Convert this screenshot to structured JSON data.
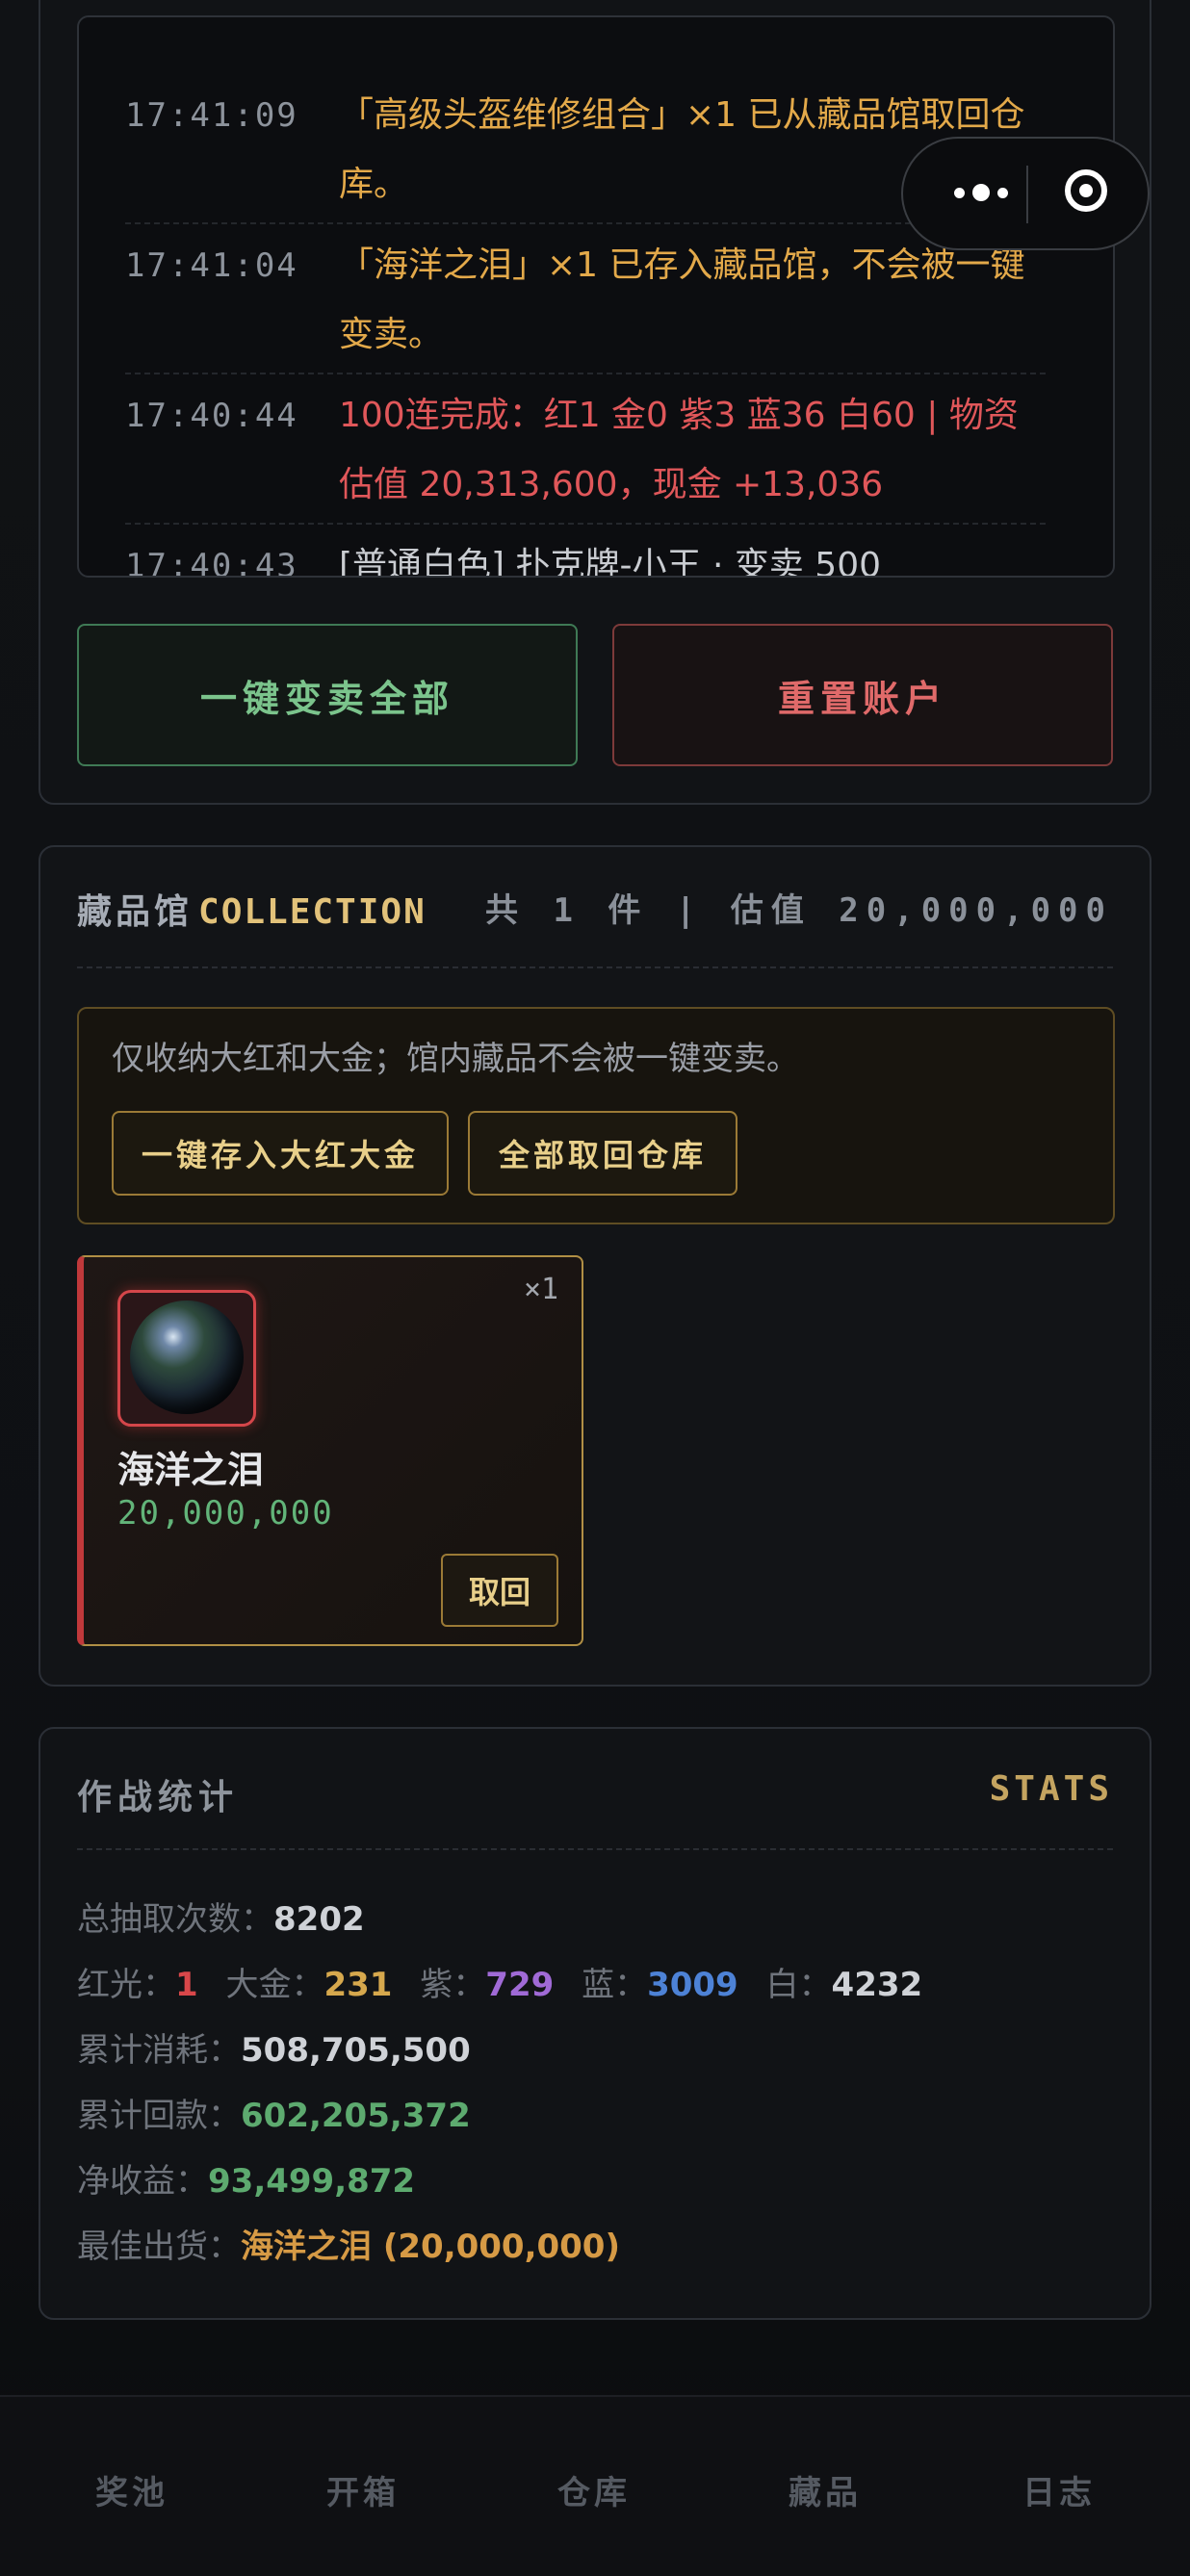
{
  "log": {
    "entries": [
      {
        "time": "17:41:09",
        "text": "「高级头盔维修组合」×1 已从藏品馆取回仓库。",
        "tone": "gold"
      },
      {
        "time": "17:41:04",
        "text": "「海洋之泪」×1 已存入藏品馆，不会被一键变卖。",
        "tone": "gold"
      },
      {
        "time": "17:40:44",
        "text": "100连完成：红1 金0 紫3 蓝36 白60 | 物资估值 20,313,600，现金 +13,036",
        "tone": "red"
      },
      {
        "time": "17:40:43",
        "text": "[普通白色] 扑克牌-小王 · 变卖 500",
        "tone": "grey"
      }
    ]
  },
  "actions": {
    "sell_all": "一键变卖全部",
    "reset_account": "重置账户"
  },
  "collection": {
    "title": "藏品馆",
    "title_en": "COLLECTION",
    "summary": "共 1 件 | 估值 20,000,000",
    "notice": "仅收纳大红和大金；馆内藏品不会被一键变卖。",
    "deposit_button": "一键存入大红大金",
    "retrieve_all_button": "全部取回仓库",
    "items": [
      {
        "name": "海洋之泪",
        "value": "20,000,000",
        "qty": "×1",
        "action": "取回",
        "rarity_color": "#c0393b"
      }
    ]
  },
  "stats": {
    "title": "作战统计",
    "title_en": "STATS",
    "total_draws_label": "总抽取次数：",
    "total_draws": "8202",
    "red_label": "红光：",
    "red": "1",
    "gold_label": "大金：",
    "gold": "231",
    "purple_label": "紫：",
    "purple": "729",
    "blue_label": "蓝：",
    "blue": "3009",
    "white_label": "白：",
    "white": "4232",
    "spent_label": "累计消耗：",
    "spent": "508,705,500",
    "returned_label": "累计回款：",
    "returned": "602,205,372",
    "net_label": "净收益：",
    "net": "93,499,872",
    "best_label": "最佳出货：",
    "best": "海洋之泪 (20,000,000)"
  },
  "tabs": [
    "奖池",
    "开箱",
    "仓库",
    "藏品",
    "日志"
  ],
  "colors": {
    "accent_gold": "#e2c27a",
    "accent_red": "#c0393b",
    "accent_green": "#62b479"
  }
}
